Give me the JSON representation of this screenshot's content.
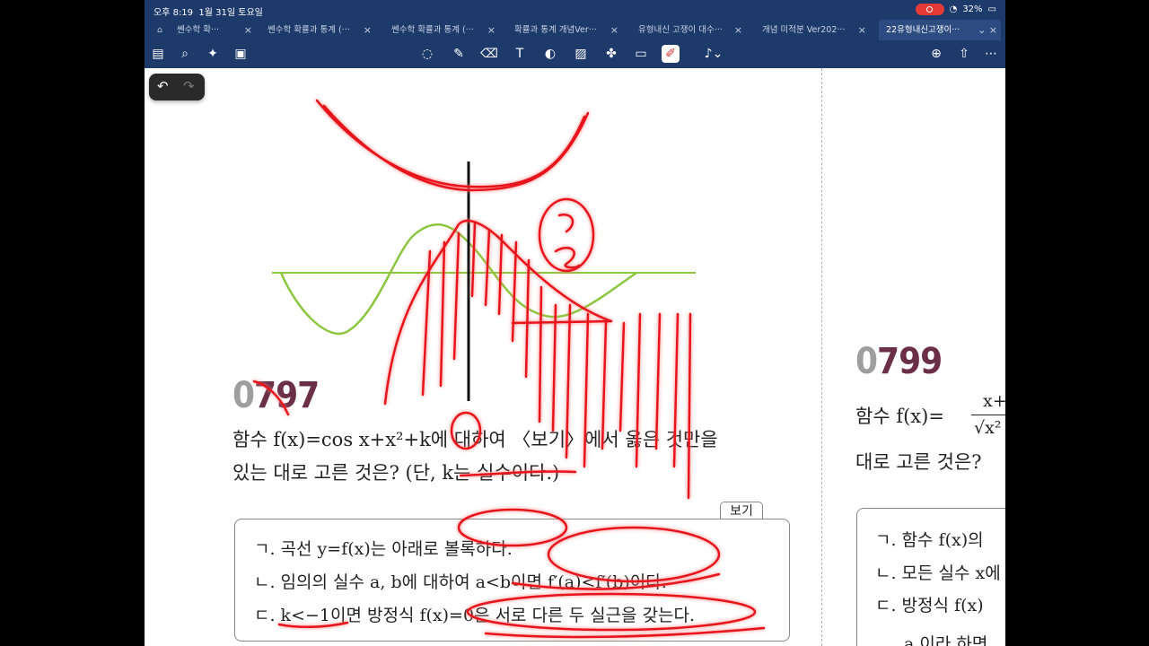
{
  "status": {
    "time": "오후 8:19",
    "date": "1월 31일 토요일",
    "battery": "32%"
  },
  "tabs": [
    {
      "label": "쎈수학 확···"
    },
    {
      "label": "쎈수학 확률과 통계 (···"
    },
    {
      "label": "쎈수학 확률과 통계 (···"
    },
    {
      "label": "확률과 통계 개념Ver···"
    },
    {
      "label": "유형내신 고쟁이 대수···"
    },
    {
      "label": "개념 미적분 Ver202···"
    },
    {
      "label": "22유형내신고쟁이···"
    }
  ],
  "problem_797": {
    "number_prefix": "0",
    "number_rest": "797",
    "line1": "함수 f(x)=cos x+x²+k에 대하여 〈보기〉에서 옳은 것만을",
    "line2": "있는 대로 고른 것은? (단, k는 실수이다.)",
    "box_label": "보기",
    "items": [
      "ㄱ. 곡선 y=f(x)는 아래로 볼록하다.",
      "ㄴ. 임의의 실수 a, b에 대하여 a<b이면 f′(a)<f′(b)이다.",
      "ㄷ. k<−1이면 방정식 f(x)=0은 서로 다른 두 실근을 갖는다."
    ]
  },
  "problem_799": {
    "number_prefix": "0",
    "number_rest": "799",
    "line1": "함수 f(x)=",
    "frac_num": "x+",
    "frac_den": "√x²",
    "line2": "대로 고른 것은?",
    "items": [
      "ㄱ. 함수 f(x)의",
      "ㄴ. 모든 실수 x에",
      "ㄷ. 방정식 f(x)",
      "a 이라 하면"
    ]
  }
}
